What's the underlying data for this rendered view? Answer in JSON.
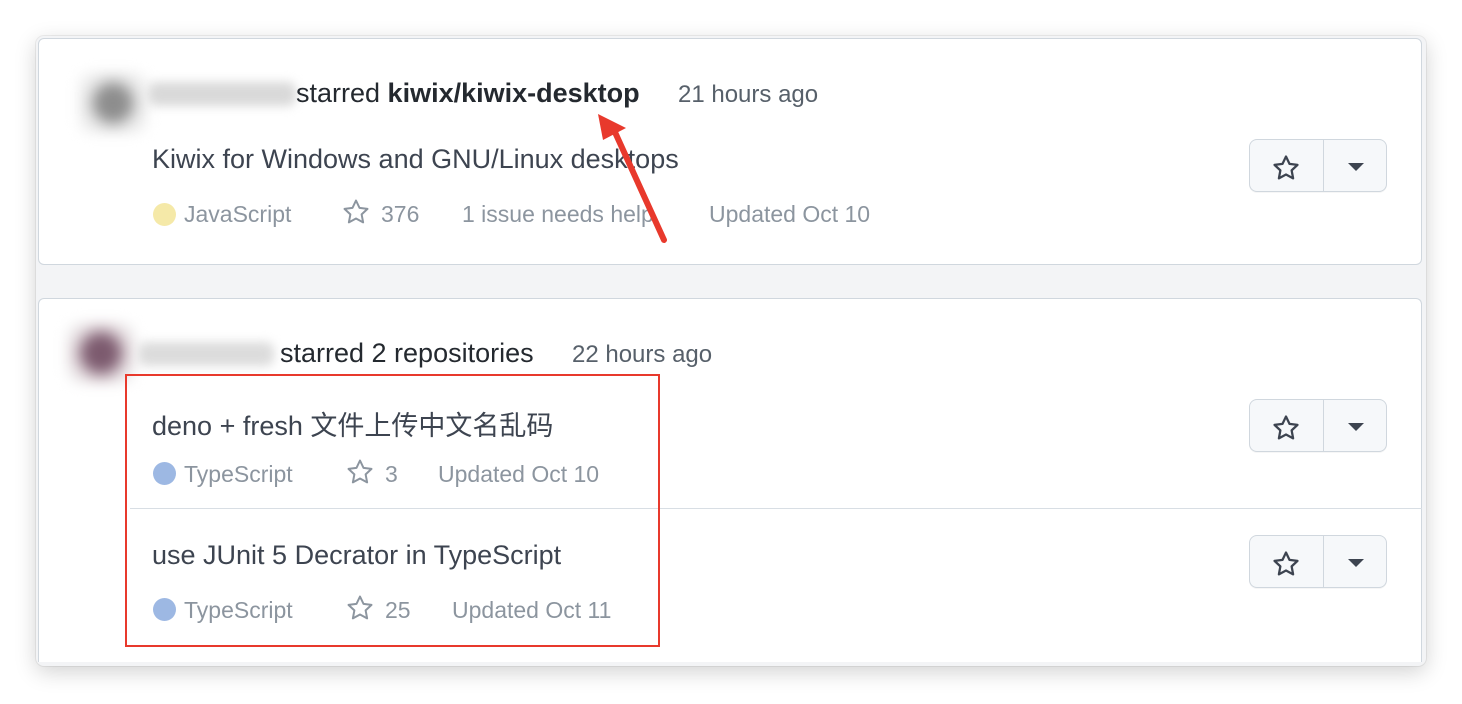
{
  "events": [
    {
      "actor_prefix": "starred ",
      "repo_link": "kiwix/kiwix-desktop",
      "time": "21 hours ago",
      "items": [
        {
          "description": "Kiwix for Windows and GNU/Linux desktops",
          "language": "JavaScript",
          "language_color": "#f1e05a",
          "stars": "376",
          "issues": "1 issue needs help",
          "updated": "Updated Oct 10"
        }
      ]
    },
    {
      "header_text": "starred 2 repositories",
      "time": "22 hours ago",
      "items": [
        {
          "description": "deno + fresh 文件上传中文名乱码",
          "language": "TypeScript",
          "language_color": "#3178c6",
          "stars": "3",
          "updated": "Updated Oct 10"
        },
        {
          "description": "use JUnit 5 Decrator in TypeScript",
          "language": "TypeScript",
          "language_color": "#3178c6",
          "stars": "25",
          "updated": "Updated Oct 11"
        }
      ]
    }
  ],
  "icons": {
    "star": "star-icon",
    "caret": "caret-down-icon",
    "annotation_arrow": "red-arrow-annotation",
    "annotation_box": "red-highlight-box"
  },
  "colors": {
    "annotation": "#e8392c",
    "javascript_dot": "#f5e9a8",
    "typescript_dot": "#9db8e3"
  }
}
